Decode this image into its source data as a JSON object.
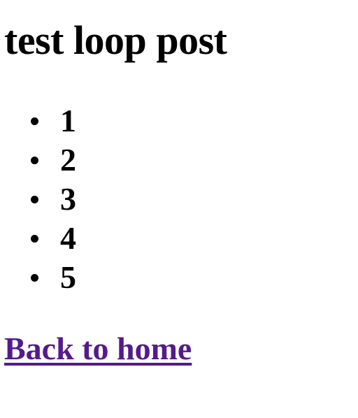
{
  "page": {
    "title": "test loop post",
    "items": [
      "1",
      "2",
      "3",
      "4",
      "5"
    ],
    "back_link_label": "Back to home",
    "link_color": "#551a8b"
  }
}
